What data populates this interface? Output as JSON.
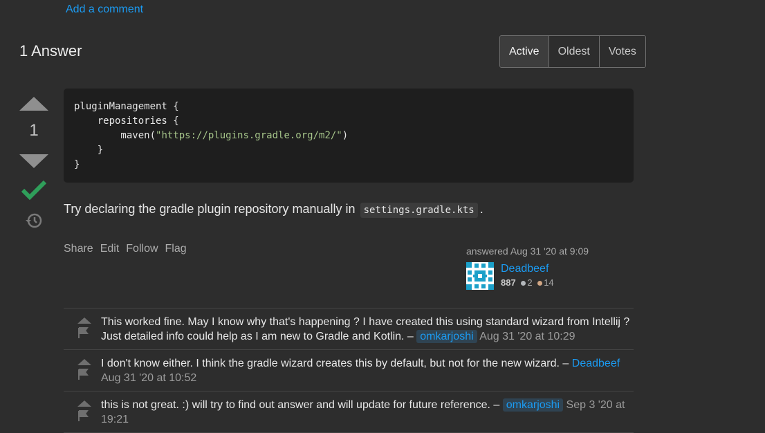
{
  "add_comment": "Add a comment",
  "answers_title": "1 Answer",
  "sort_tabs": [
    "Active",
    "Oldest",
    "Votes"
  ],
  "vote": {
    "count": "1"
  },
  "code_lines": [
    "pluginManagement {",
    "    repositories {",
    "        maven(",
    "\"https://plugins.gradle.org/m2/\"",
    ")",
    "    }",
    "}"
  ],
  "answer": {
    "text_before": "Try declaring the gradle plugin repository manually in",
    "inline_code": "settings.gradle.kts",
    "text_after": "."
  },
  "post_menu": [
    "Share",
    "Edit",
    "Follow",
    "Flag"
  ],
  "user_card": {
    "action": "answered Aug 31 '20 at 9:09",
    "name": "Deadbeef",
    "reputation": "887",
    "silver": "2",
    "bronze": "14"
  },
  "comments": [
    {
      "text": "This worked fine. May I know why that's happening ? I have created this using standard wizard from Intellij ? Just detailed info could help as I am new to Gradle and Kotlin. –",
      "user": "omkarjoshi",
      "date": "Aug 31 '20 at 10:29"
    },
    {
      "text": "I don't know either. I think the gradle wizard creates this by default, but not for the new wizard. –",
      "user": "Deadbeef",
      "date": "Aug 31 '20 at 10:52"
    },
    {
      "text": "this is not great. :) will try to find out answer and will update for future reference. –",
      "user": "omkarjoshi",
      "date": "Sep 3 '20 at 19:21"
    }
  ],
  "colors": {
    "accent": "#1b9bf2",
    "accepted": "#2f9e5a",
    "silver": "#b4b8bc",
    "bronze": "#d1a684"
  }
}
